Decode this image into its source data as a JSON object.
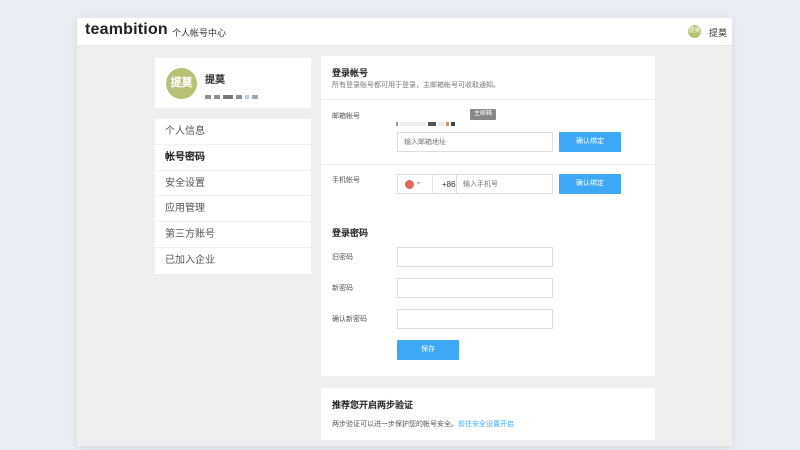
{
  "header": {
    "logo": "teambition",
    "title": "个人帐号中心",
    "avatar_text": "提莫",
    "user_name": "提莫"
  },
  "profile": {
    "avatar_text": "提莫",
    "name": "提莫"
  },
  "nav": {
    "items": [
      {
        "label": "个人信息",
        "active": false
      },
      {
        "label": "帐号密码",
        "active": true
      },
      {
        "label": "安全设置",
        "active": false
      },
      {
        "label": "应用管理",
        "active": false
      },
      {
        "label": "第三方账号",
        "active": false
      },
      {
        "label": "已加入企业",
        "active": false
      }
    ]
  },
  "login_account": {
    "title": "登录帐号",
    "subtitle": "所有登录账号都可用于登录，主邮箱帐号可收取通知。",
    "email_label": "邮箱帐号",
    "primary_badge": "主邮箱",
    "email_placeholder": "输入邮箱地址",
    "email_button": "确认绑定",
    "phone_label": "手机帐号",
    "country_code": "+86",
    "phone_placeholder": "输入手机号",
    "phone_button": "确认绑定"
  },
  "password": {
    "title": "登录密码",
    "old_label": "旧密码",
    "new_label": "新密码",
    "confirm_label": "确认新密码",
    "save_button": "保存"
  },
  "two_step": {
    "title": "推荐您开启两步验证",
    "text": "两步验证可以进一步保护您的帐号安全。",
    "link": "前往安全设置开启"
  },
  "colors": {
    "accent": "#3da8f5",
    "avatar": "#b8c277"
  }
}
